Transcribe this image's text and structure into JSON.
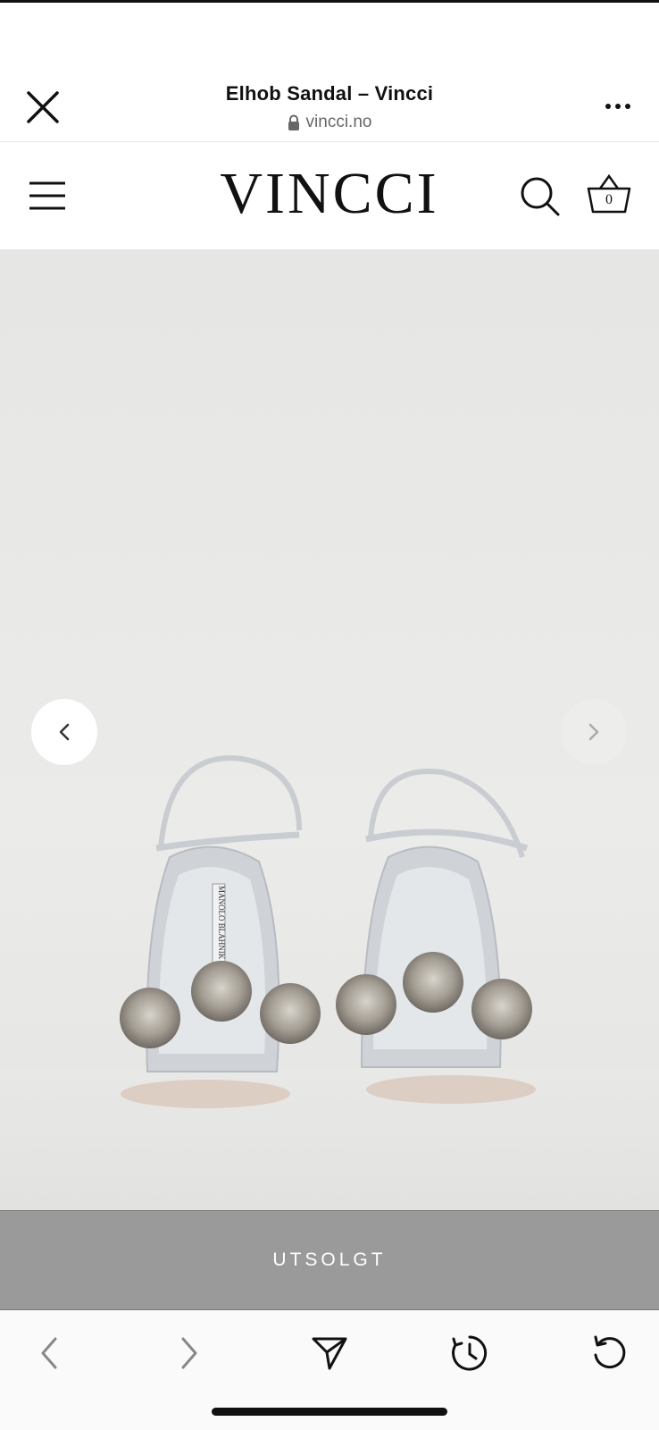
{
  "browser": {
    "title": "Elhob Sandal – Vincci",
    "url": "vincci.no",
    "icons": {
      "close": "close-icon",
      "lock": "lock-icon",
      "more": "more-horizontal-icon"
    }
  },
  "site_header": {
    "logo": "VINCCI",
    "cart_count": "0",
    "icons": {
      "menu": "hamburger-menu-icon",
      "search": "search-icon",
      "cart": "basket-icon"
    }
  },
  "gallery": {
    "image_brand_text": "MANOLO BLAHNIK",
    "icons": {
      "prev": "chevron-left-icon",
      "next": "chevron-right-icon"
    }
  },
  "product": {
    "status_label": "UTSOLGT"
  },
  "toolbar": {
    "icons": [
      "back-arrow-icon",
      "forward-arrow-icon",
      "share-send-icon",
      "history-clock-icon",
      "reload-icon"
    ]
  },
  "colors": {
    "soldout_bg": "#9a9a9a",
    "gallery_bg": "#e8e8e6",
    "text": "#111111"
  }
}
